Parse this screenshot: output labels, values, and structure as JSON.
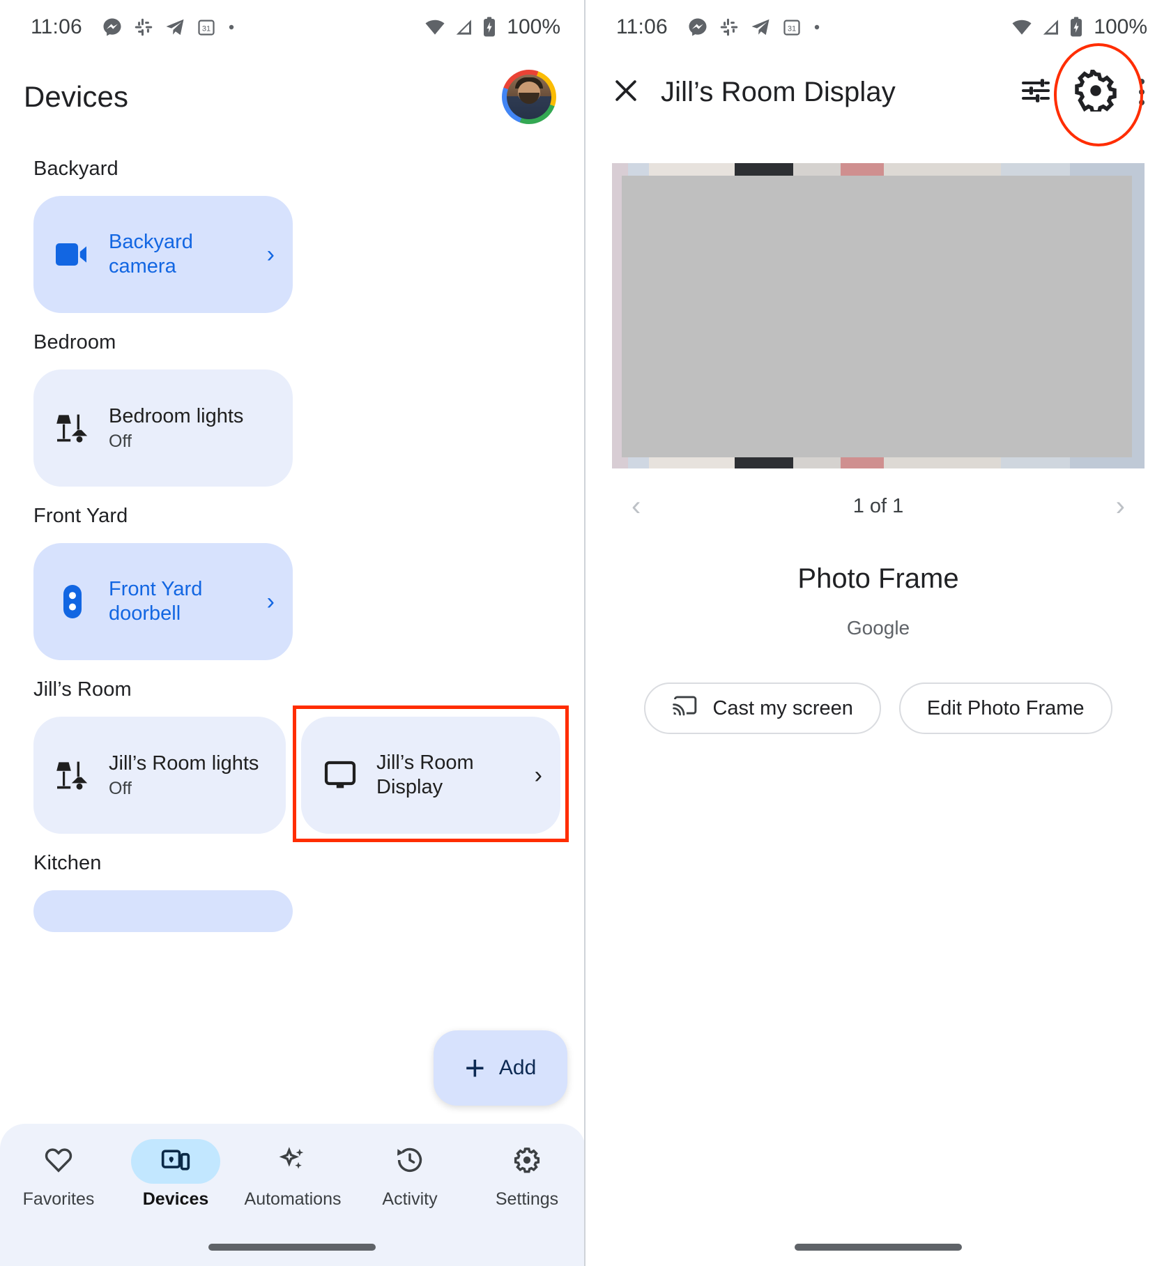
{
  "status_bar": {
    "time": "11:06",
    "battery_pct": "100%",
    "left_icons": [
      "messenger-icon",
      "slack-icon",
      "telegram-icon",
      "calendar-31-icon",
      "dot-icon"
    ],
    "right_icons": [
      "wifi-icon",
      "cellular-signal-icon",
      "battery-charging-icon"
    ]
  },
  "left_panel": {
    "title": "Devices",
    "avatar_name": "account-avatar",
    "groups": [
      {
        "room": "Backyard",
        "devices": [
          {
            "name": "Backyard camera",
            "state": "",
            "icon": "video-camera-icon",
            "accent": true,
            "chevron": true
          }
        ]
      },
      {
        "room": "Bedroom",
        "devices": [
          {
            "name": "Bedroom lights",
            "state": "Off",
            "icon": "lamp-icon",
            "accent": false,
            "chevron": false
          }
        ]
      },
      {
        "room": "Front Yard",
        "devices": [
          {
            "name": "Front Yard doorbell",
            "state": "",
            "icon": "doorbell-icon",
            "accent": true,
            "chevron": true
          }
        ]
      },
      {
        "room": "Jill’s Room",
        "devices": [
          {
            "name": "Jill’s Room lights",
            "state": "Off",
            "icon": "lamp-icon",
            "accent": false,
            "chevron": false
          },
          {
            "name": "Jill’s Room Display",
            "state": "",
            "icon": "display-monitor-icon",
            "accent": false,
            "chevron": true,
            "highlighted": true
          }
        ]
      },
      {
        "room": "Kitchen",
        "devices": []
      }
    ],
    "add_button": {
      "label": "Add",
      "icon": "plus-icon"
    },
    "bottom_nav": [
      {
        "label": "Favorites",
        "icon": "heart-icon",
        "active": false
      },
      {
        "label": "Devices",
        "icon": "devices-icon",
        "active": true
      },
      {
        "label": "Automations",
        "icon": "sparkle-icon",
        "active": false
      },
      {
        "label": "Activity",
        "icon": "history-clock-icon",
        "active": false
      },
      {
        "label": "Settings",
        "icon": "gear-icon",
        "active": false
      }
    ]
  },
  "right_panel": {
    "close_icon": "close-x-icon",
    "title": "Jill’s Room Display",
    "tune_icon": "tune-sliders-icon",
    "settings_icon": "gear-icon",
    "overflow_icon": "more-vertical-icon",
    "photo": {
      "alt": "device-photo-preview",
      "pager_text": "1 of 1",
      "prev_icon": "chevron-left-icon",
      "next_icon": "chevron-right-icon"
    },
    "device_name": "Photo Frame",
    "device_maker": "Google",
    "buttons": [
      {
        "label": "Cast my screen",
        "icon": "cast-icon"
      },
      {
        "label": "Edit Photo Frame",
        "icon": ""
      }
    ]
  },
  "annotations": {
    "highlight_color": "#ff2d00",
    "highlight_targets": [
      "jills-room-display-card",
      "settings-gear-button"
    ]
  }
}
